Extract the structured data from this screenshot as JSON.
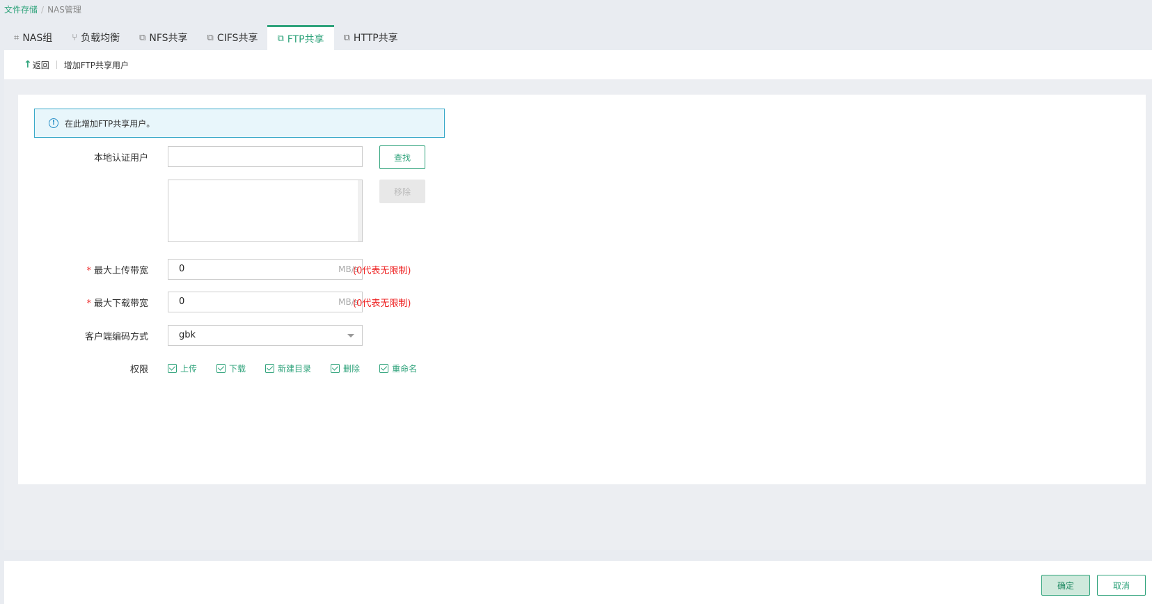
{
  "breadcrumb": {
    "root": "文件存储",
    "current": "NAS管理"
  },
  "tabs": [
    {
      "label": "NAS组",
      "icon": "group-icon"
    },
    {
      "label": "负载均衡",
      "icon": "balance-icon"
    },
    {
      "label": "NFS共享",
      "icon": "share-icon"
    },
    {
      "label": "CIFS共享",
      "icon": "share-icon"
    },
    {
      "label": "FTP共享",
      "icon": "share-icon",
      "active": true
    },
    {
      "label": "HTTP共享",
      "icon": "share-icon"
    }
  ],
  "subbar": {
    "back": "返回",
    "title": "增加FTP共享用户"
  },
  "info": {
    "text": "在此增加FTP共享用户。"
  },
  "form": {
    "local_user_label": "本地认证用户",
    "local_user_value": "",
    "search_button": "查找",
    "remove_button": "移除",
    "upload_label": "最大上传带宽",
    "upload_value": "0",
    "upload_unit": "MB/s",
    "upload_hint": "(0代表无限制)",
    "download_label": "最大下载带宽",
    "download_value": "0",
    "download_unit": "MB/s",
    "download_hint": "(0代表无限制)",
    "encoding_label": "客户端编码方式",
    "encoding_value": "gbk",
    "perm_label": "权限",
    "required_mark": "*",
    "permissions": [
      {
        "label": "上传",
        "checked": true
      },
      {
        "label": "下载",
        "checked": true
      },
      {
        "label": "新建目录",
        "checked": true
      },
      {
        "label": "删除",
        "checked": true
      },
      {
        "label": "重命名",
        "checked": true
      }
    ]
  },
  "footer": {
    "ok": "确定",
    "cancel": "取消"
  },
  "colors": {
    "accent": "#2fa37b",
    "error": "#e22222",
    "info_border": "#3aa9c9"
  }
}
